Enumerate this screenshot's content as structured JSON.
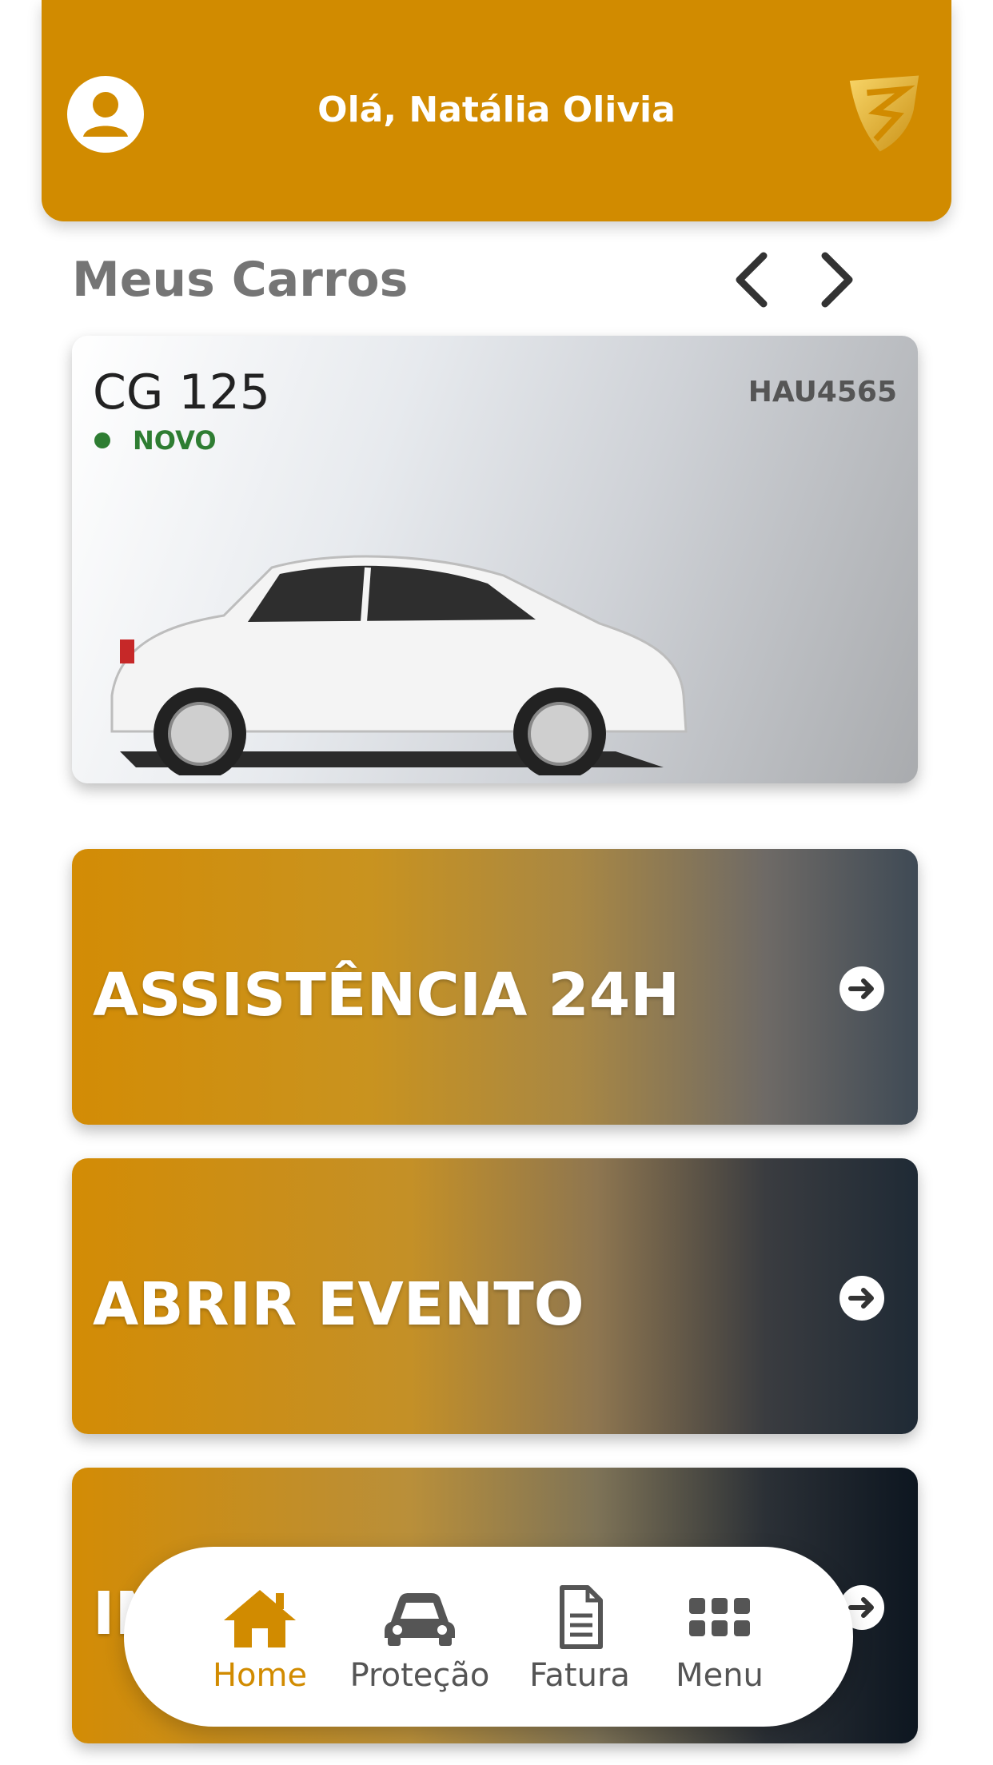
{
  "header": {
    "greeting": "Olá, Natália Olivia"
  },
  "section": {
    "title": "Meus Carros"
  },
  "car": {
    "model": "CG 125",
    "status": "NOVO",
    "plate": "HAU4565"
  },
  "actions": [
    {
      "label": "ASSISTÊNCIA 24H"
    },
    {
      "label": "ABRIR EVENTO"
    },
    {
      "label": "IN"
    }
  ],
  "nav": [
    {
      "label": "Home",
      "icon": "home-icon",
      "active": true
    },
    {
      "label": "Proteção",
      "icon": "car-icon"
    },
    {
      "label": "Fatura",
      "icon": "document-icon"
    },
    {
      "label": "Menu",
      "icon": "grid-icon"
    }
  ],
  "colors": {
    "primary": "#d18b00",
    "status_green": "#2e7d32",
    "title_gray": "#757575"
  }
}
